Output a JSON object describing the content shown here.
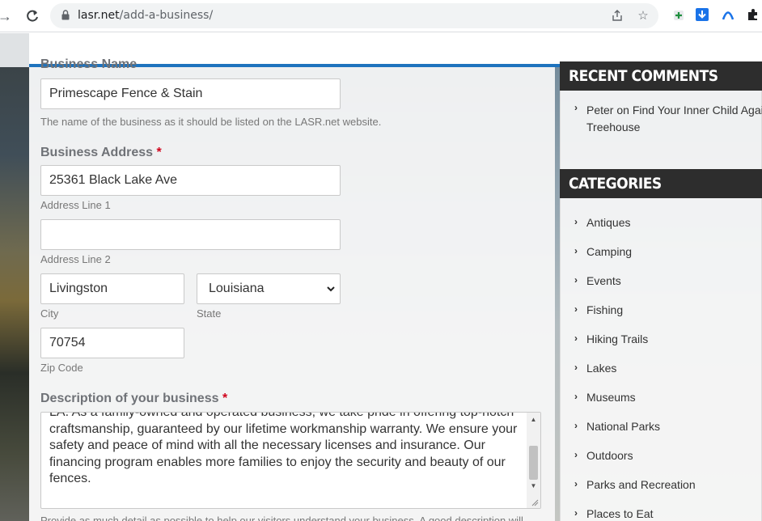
{
  "browser": {
    "url_host": "lasr.net",
    "url_path": "/add-a-business/"
  },
  "form": {
    "business_name_label_partial": "Business Name",
    "business_name_value": "Primescape Fence & Stain",
    "business_name_hint": "The name of the business as it should be listed on the LASR.net website.",
    "address_label": "Business Address",
    "required_mark": "*",
    "address_line1_value": "25361 Black Lake Ave",
    "address_line1_hint": "Address Line 1",
    "address_line2_value": "",
    "address_line2_hint": "Address Line 2",
    "city_value": "Livingston",
    "city_hint": "City",
    "state_value": "Louisiana",
    "state_hint": "State",
    "zip_value": "70754",
    "zip_hint": "Zip Code",
    "description_label": "Description of your business",
    "description_lines": [
      "LA. As a family-owned and operated business, we take pride in offering top-notch",
      "craftsmanship, guaranteed by our lifetime workmanship warranty. We ensure your",
      "safety and peace of mind with all the necessary licenses and insurance. Our",
      "financing program enables more families to enjoy the security and beauty of our",
      "fences."
    ],
    "description_hint_partial": "Provide as much detail as possible to help our visitors understand your business. A good description will"
  },
  "sidebar": {
    "recent_comments_title": "RECENT COMMENTS",
    "comment_author": "Peter",
    "comment_on": "on",
    "comment_post_line1": "Find Your Inner Child Again in",
    "comment_post_line2": "Treehouse",
    "categories_title": "CATEGORIES",
    "categories": [
      "Antiques",
      "Camping",
      "Events",
      "Fishing",
      "Hiking Trails",
      "Lakes",
      "Museums",
      "National Parks",
      "Outdoors",
      "Parks and Recreation",
      "Places to Eat"
    ]
  }
}
